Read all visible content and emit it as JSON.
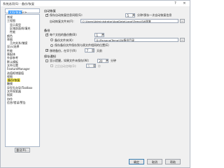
{
  "window": {
    "title": "系统选项(S) - 备份/恢复",
    "buttons": [
      "?",
      "✕"
    ]
  },
  "search": {
    "value_prefix": "系统选项(S) > ",
    "value_selected": "文档/恢复"
  },
  "tree": {
    "items": [
      {
        "label": "常规",
        "level": 0
      },
      {
        "label": "工程图",
        "level": 0
      },
      {
        "label": "显示类型",
        "level": 1
      },
      {
        "label": "区域剖面线/填充",
        "level": 1
      },
      {
        "label": "性能",
        "level": 1
      },
      {
        "label": "颜色",
        "level": 0
      },
      {
        "label": "草图",
        "level": 0
      },
      {
        "label": "几何关系/捕捉",
        "level": 1
      },
      {
        "label": "显示/选择",
        "level": 0
      },
      {
        "label": "性能",
        "level": 0
      },
      {
        "label": "装配体",
        "level": 0
      },
      {
        "label": "外部参考",
        "level": 0
      },
      {
        "label": "默认模板",
        "level": 0
      },
      {
        "label": "文件位置",
        "level": 0
      },
      {
        "label": "FeatureManager",
        "level": 0
      },
      {
        "label": "选值框增量值",
        "level": 0
      },
      {
        "label": "视图",
        "level": 0
      },
      {
        "label": "备份/恢复",
        "level": 0,
        "selected": true
      },
      {
        "label": "触摸",
        "level": 0
      },
      {
        "label": "异型孔向导/Toolbox",
        "level": 0
      },
      {
        "label": "文件探索器",
        "level": 0
      },
      {
        "label": "搜索",
        "level": 0
      },
      {
        "label": "协作",
        "level": 0
      },
      {
        "label": "信息/错误/警告",
        "level": 0
      }
    ]
  },
  "reset_button": "重设(R)...",
  "autorecover": {
    "group_label": "自动恢复",
    "enable_label": "保存自动恢复信息间距(S):",
    "interval_value": "5",
    "interval_unit": "分钟/保存一次自动恢复信息",
    "folder_label": "自动恢复文件夹(F):",
    "folder_value": "C:\\Users\\Administrator\\AppData\\Local\\Temp\\SW恢复",
    "browse": "..."
  },
  "backup": {
    "group_label": "备份",
    "copies_label": "每个文档的备份数(B):",
    "copies_value": "1",
    "folder_label": "备份文件夹(K):",
    "folder_value": "D:\\PersonalTemp\\SW备份目录",
    "browse": "...",
    "same_folder_label": "保存备份文件保存到与原文件相同的位置(E)",
    "remove_label": "移除备份，在早于(R)",
    "remove_value": "7",
    "remove_unit": "天前"
  },
  "save_notice": {
    "group_label": "保存通知",
    "show_reminder_label": "显示提醒，如果文件未保存(W):",
    "reminder_value": "20",
    "reminder_unit": "分钟",
    "auto_dismiss_label": "之后自动忽略(D):",
    "dismiss_value": "5",
    "dismiss_unit": "秒"
  },
  "dialog": {
    "ok": "确定",
    "cancel": "取消",
    "help": "帮助"
  },
  "colors": {
    "highlight": "#fff35a",
    "selection_blue": "#3297fd"
  }
}
